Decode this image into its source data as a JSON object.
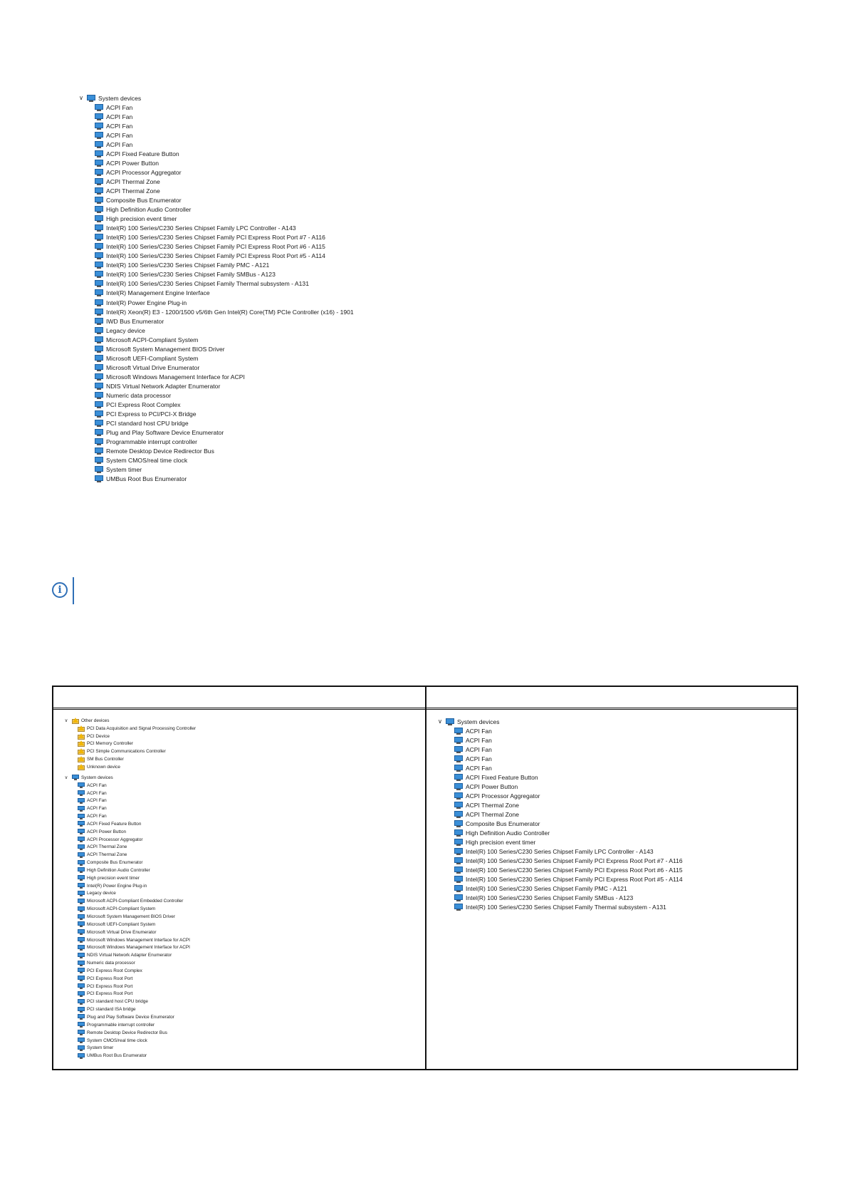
{
  "top_tree": {
    "root_label": "System devices",
    "items": [
      "ACPI Fan",
      "ACPI Fan",
      "ACPI Fan",
      "ACPI Fan",
      "ACPI Fan",
      "ACPI Fixed Feature Button",
      "ACPI Power Button",
      "ACPI Processor Aggregator",
      "ACPI Thermal Zone",
      "ACPI Thermal Zone",
      "Composite Bus Enumerator",
      "High Definition Audio Controller",
      "High precision event timer",
      "Intel(R) 100 Series/C230 Series Chipset Family LPC Controller - A143",
      "Intel(R) 100 Series/C230 Series Chipset Family PCI Express Root Port #7 - A116",
      "Intel(R) 100 Series/C230 Series Chipset Family PCI Express Root Port #6 - A115",
      "Intel(R) 100 Series/C230 Series Chipset Family PCI Express Root Port #5 - A114",
      "Intel(R) 100 Series/C230 Series Chipset Family PMC - A121",
      "Intel(R) 100 Series/C230 Series Chipset Family SMBus - A123",
      "Intel(R) 100 Series/C230 Series Chipset Family Thermal subsystem - A131",
      "Intel(R) Management Engine Interface",
      "Intel(R) Power Engine Plug-in",
      "Intel(R) Xeon(R) E3 - 1200/1500 v5/6th Gen Intel(R) Core(TM) PCIe Controller (x16) - 1901",
      "IWD Bus Enumerator",
      "Legacy device",
      "Microsoft ACPI-Compliant System",
      "Microsoft System Management BIOS Driver",
      "Microsoft UEFI-Compliant System",
      "Microsoft Virtual Drive Enumerator",
      "Microsoft Windows Management Interface for ACPI",
      "NDIS Virtual Network Adapter Enumerator",
      "Numeric data processor",
      "PCI Express Root Complex",
      "PCI Express to PCI/PCI-X Bridge",
      "PCI standard host CPU bridge",
      "Plug and Play Software Device Enumerator",
      "Programmable interrupt controller",
      "Remote Desktop Device Redirector Bus",
      "System CMOS/real time clock",
      "System timer",
      "UMBus Root Bus Enumerator"
    ]
  },
  "table": {
    "header_left": "",
    "header_right": "",
    "left": {
      "other_root": "Other devices",
      "other_items": [
        "PCI Data Acquisition and Signal Processing Controller",
        "PCI Device",
        "PCI Memory Controller",
        "PCI Simple Communications Controller",
        "SM Bus Controller",
        "Unknown device"
      ],
      "system_root": "System devices",
      "system_items": [
        "ACPI Fan",
        "ACPI Fan",
        "ACPI Fan",
        "ACPI Fan",
        "ACPI Fan",
        "ACPI Fixed Feature Button",
        "ACPI Power Button",
        "ACPI Processor Aggregator",
        "ACPI Thermal Zone",
        "ACPI Thermal Zone",
        "Composite Bus Enumerator",
        "High Definition Audio Controller",
        "High precision event timer",
        "Intel(R) Power Engine Plug-in",
        "Legacy device",
        "Microsoft ACPI-Compliant Embedded Controller",
        "Microsoft ACPI-Compliant System",
        "Microsoft System Management BIOS Driver",
        "Microsoft UEFI-Compliant System",
        "Microsoft Virtual Drive Enumerator",
        "Microsoft Windows Management Interface for ACPI",
        "Microsoft Windows Management Interface for ACPI",
        "NDIS Virtual Network Adapter Enumerator",
        "Numeric data processor",
        "PCI Express Root Complex",
        "PCI Express Root Port",
        "PCI Express Root Port",
        "PCI Express Root Port",
        "PCI standard host CPU bridge",
        "PCI standard ISA bridge",
        "Plug and Play Software Device Enumerator",
        "Programmable interrupt controller",
        "Remote Desktop Device Redirector Bus",
        "System CMOS/real time clock",
        "System timer",
        "UMBus Root Bus Enumerator"
      ]
    },
    "right": {
      "root_label": "System devices",
      "items": [
        "ACPI Fan",
        "ACPI Fan",
        "ACPI Fan",
        "ACPI Fan",
        "ACPI Fan",
        "ACPI Fixed Feature Button",
        "ACPI Power Button",
        "ACPI Processor Aggregator",
        "ACPI Thermal Zone",
        "ACPI Thermal Zone",
        "Composite Bus Enumerator",
        "High Definition Audio Controller",
        "High precision event timer",
        "Intel(R) 100 Series/C230 Series Chipset Family LPC Controller - A143",
        "Intel(R) 100 Series/C230 Series Chipset Family PCI Express Root Port #7 - A116",
        "Intel(R) 100 Series/C230 Series Chipset Family PCI Express Root Port #6 - A115",
        "Intel(R) 100 Series/C230 Series Chipset Family PCI Express Root Port #5 - A114",
        "Intel(R) 100 Series/C230 Series Chipset Family PMC - A121",
        "Intel(R) 100 Series/C230 Series Chipset Family SMBus - A123",
        "Intel(R) 100 Series/C230 Series Chipset Family Thermal subsystem - A131"
      ]
    }
  }
}
